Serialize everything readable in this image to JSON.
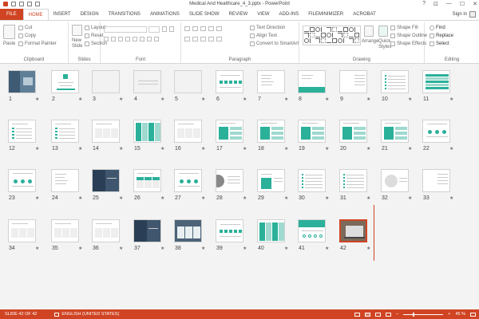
{
  "window": {
    "title": "Medical And Healthcare_4_3.pptx - PowerPoint",
    "controls": [
      "?",
      "⊡",
      "—",
      "☐",
      "✕"
    ]
  },
  "tabs": [
    {
      "label": "FILE",
      "kind": "file"
    },
    {
      "label": "HOME",
      "kind": "active"
    },
    {
      "label": "INSERT",
      "kind": ""
    },
    {
      "label": "DESIGN",
      "kind": ""
    },
    {
      "label": "TRANSITIONS",
      "kind": ""
    },
    {
      "label": "ANIMATIONS",
      "kind": ""
    },
    {
      "label": "SLIDE SHOW",
      "kind": ""
    },
    {
      "label": "REVIEW",
      "kind": ""
    },
    {
      "label": "VIEW",
      "kind": ""
    },
    {
      "label": "ADD-INS",
      "kind": ""
    },
    {
      "label": "FILEminimizer",
      "kind": ""
    },
    {
      "label": "ACROBAT",
      "kind": ""
    }
  ],
  "sign_in": "Sign in",
  "ribbon": {
    "clipboard": {
      "label": "Clipboard",
      "paste": "Paste",
      "cut": "Cut",
      "copy": "Copy",
      "format_painter": "Format Painter"
    },
    "slides": {
      "label": "Slides",
      "new_slide": "New",
      "new_slide2": "Slide",
      "layout": "Layout",
      "reset": "Reset",
      "section": "Section"
    },
    "font": {
      "label": "Font"
    },
    "paragraph": {
      "label": "Paragraph",
      "text_direction": "Text Direction",
      "align_text": "Align Text",
      "convert_smartart": "Convert to SmartArt"
    },
    "drawing": {
      "label": "Drawing",
      "arrange": "Arrange",
      "quick_styles": "Quick",
      "quick_styles2": "Styles",
      "shape_fill": "Shape Fill",
      "shape_outline": "Shape Outline",
      "shape_effects": "Shape Effects"
    },
    "editing": {
      "label": "Editing",
      "find": "Find",
      "replace": "Replace",
      "select": "Select"
    }
  },
  "slides": [
    {
      "n": "1",
      "style": "photo"
    },
    {
      "n": "2",
      "style": "centered"
    },
    {
      "n": "3",
      "style": "blank"
    },
    {
      "n": "4",
      "style": "blank-lines"
    },
    {
      "n": "5",
      "style": "blank"
    },
    {
      "n": "6",
      "style": "icons"
    },
    {
      "n": "7",
      "style": "text-left"
    },
    {
      "n": "8",
      "style": "text-teal"
    },
    {
      "n": "9",
      "style": "text-right"
    },
    {
      "n": "10",
      "style": "list"
    },
    {
      "n": "11",
      "style": "teal-list"
    },
    {
      "n": "12",
      "style": "rows"
    },
    {
      "n": "13",
      "style": "rows"
    },
    {
      "n": "14",
      "style": "columns"
    },
    {
      "n": "15",
      "style": "teal-columns"
    },
    {
      "n": "16",
      "style": "columns"
    },
    {
      "n": "17",
      "style": "teal-blocks"
    },
    {
      "n": "18",
      "style": "teal-blocks"
    },
    {
      "n": "19",
      "style": "teal-blocks"
    },
    {
      "n": "20",
      "style": "teal-blocks"
    },
    {
      "n": "21",
      "style": "teal-blocks"
    },
    {
      "n": "22",
      "style": "dots"
    },
    {
      "n": "23",
      "style": "dots"
    },
    {
      "n": "24",
      "style": "text-left"
    },
    {
      "n": "25",
      "style": "dark-photo"
    },
    {
      "n": "26",
      "style": "cards"
    },
    {
      "n": "27",
      "style": "dots"
    },
    {
      "n": "28",
      "style": "circle-photo"
    },
    {
      "n": "29",
      "style": "teal-bar"
    },
    {
      "n": "30",
      "style": "list"
    },
    {
      "n": "31",
      "style": "list"
    },
    {
      "n": "32",
      "style": "circle"
    },
    {
      "n": "33",
      "style": "text-right"
    },
    {
      "n": "34",
      "style": "columns"
    },
    {
      "n": "35",
      "style": "columns"
    },
    {
      "n": "36",
      "style": "columns"
    },
    {
      "n": "37",
      "style": "dark-photo"
    },
    {
      "n": "38",
      "style": "dark-cards"
    },
    {
      "n": "39",
      "style": "icons"
    },
    {
      "n": "40",
      "style": "teal-columns"
    },
    {
      "n": "41",
      "style": "teal-header"
    },
    {
      "n": "42",
      "style": "laptop"
    }
  ],
  "status": {
    "slide_of": "SLIDE 42 OF 42",
    "language": "ENGLISH (UNITED STATES)",
    "zoom": "45 %"
  },
  "colors": {
    "accent": "#d04423",
    "teal": "#2bb09a"
  }
}
